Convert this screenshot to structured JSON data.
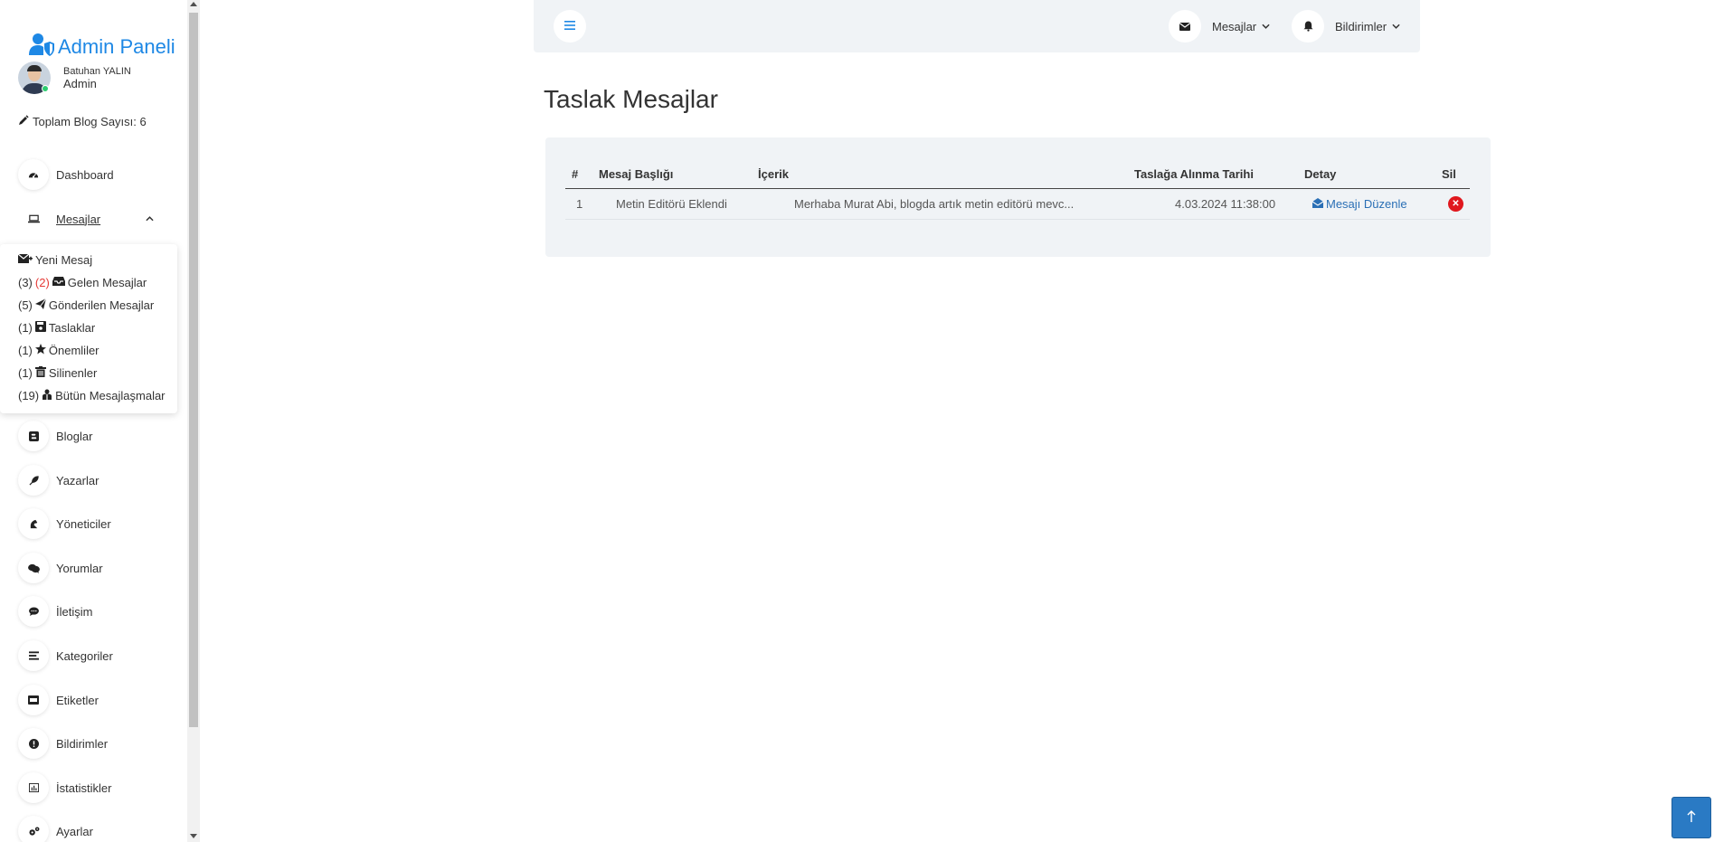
{
  "brand": {
    "title": "Admin Paneli"
  },
  "profile": {
    "name": "Batuhan YALIN",
    "role": "Admin"
  },
  "blog_count": "Toplam Blog Sayısı: 6",
  "nav": {
    "dashboard": "Dashboard",
    "mesajlar": "Mesajlar",
    "bloglar": "Bloglar",
    "yazarlar": "Yazarlar",
    "yoneticiler": "Yöneticiler",
    "yorumlar": "Yorumlar",
    "iletisim": "İletişim",
    "kategoriler": "Kategoriler",
    "etiketler": "Etiketler",
    "bildirimler": "Bildirimler",
    "istatistikler": "İstatistikler",
    "ayarlar": "Ayarlar"
  },
  "submenu": {
    "yeni_mesaj": "Yeni Mesaj",
    "gelen_count": "(3)",
    "gelen_unread": "(2)",
    "gelen": "Gelen Mesajlar",
    "gonderilen_count": "(5)",
    "gonderilen": "Gönderilen Mesajlar",
    "taslaklar_count": "(1)",
    "taslaklar": "Taslaklar",
    "onemliler_count": "(1)",
    "onemliler": "Önemliler",
    "silinenler_count": "(1)",
    "silinenler": "Silinenler",
    "butun_count": "(19)",
    "butun": "Bütün Mesajlaşmalar"
  },
  "topbar": {
    "messages": "Mesajlar",
    "notifications": "Bildirimler"
  },
  "page_title": "Taslak Mesajlar",
  "table": {
    "headers": [
      "#",
      "Mesaj Başlığı",
      "İçerik",
      "Taslağa Alınma Tarihi",
      "Detay",
      "Sil"
    ],
    "rows": [
      {
        "no": "1",
        "title": "Metin Editörü Eklendi",
        "content": "Merhaba Murat Abi, blogda artık metin editörü mevc...",
        "date": "4.03.2024 11:38:00",
        "action": "Mesajı Düzenle"
      }
    ]
  },
  "colors": {
    "accent": "#1e88e5",
    "danger": "#e0181e",
    "link": "#2a6fb5",
    "panel": "#f0f3f6"
  },
  "icons": [
    "user-shield-icon",
    "pen-icon",
    "gauge-icon",
    "laptop-icon",
    "envelope-plus-icon",
    "inbox-icon",
    "paper-plane-icon",
    "floppy-icon",
    "star-icon",
    "trash-icon",
    "users-icon",
    "blogger-icon",
    "feather-icon",
    "chess-knight-icon",
    "comments-icon",
    "comment-dots-icon",
    "list-icon",
    "tag-icon",
    "exclamation-icon",
    "chart-icon",
    "gears-icon",
    "bars-icon",
    "envelope-icon",
    "bell-icon",
    "envelope-open-icon",
    "x-circle-icon",
    "arrow-up-icon"
  ]
}
